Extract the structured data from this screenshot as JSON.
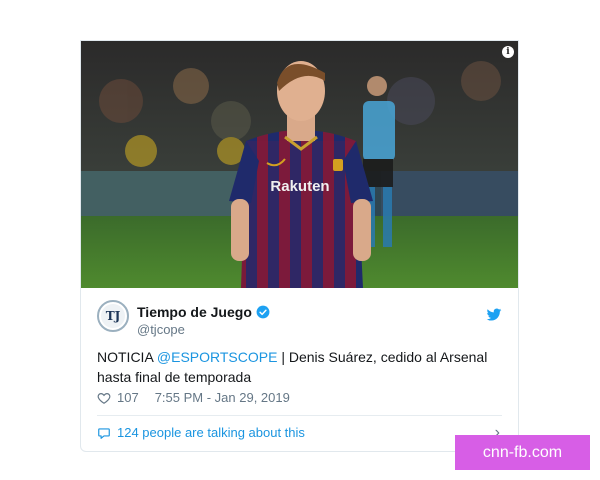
{
  "tweet": {
    "display_name": "Tiempo de Juego",
    "handle": "@tjcope",
    "avatar_text": "TJ",
    "text_prefix": "NOTICIA ",
    "mention": "@ESPORTSCOPE",
    "text_suffix": " | Denis Suárez, cedido al Arsenal hasta final de temporada",
    "likes": "107",
    "timestamp": "7:55 PM - Jan 29, 2019",
    "talking": "124 people are talking about this",
    "info_glyph": "i"
  },
  "photo": {
    "jersey_text": "Rakuten"
  },
  "watermark": "cnn-fb.com",
  "colors": {
    "link": "#1b95e0",
    "secondary": "#657786",
    "verified": "#1da1f2",
    "watermark_bg": "#d75ee6"
  }
}
